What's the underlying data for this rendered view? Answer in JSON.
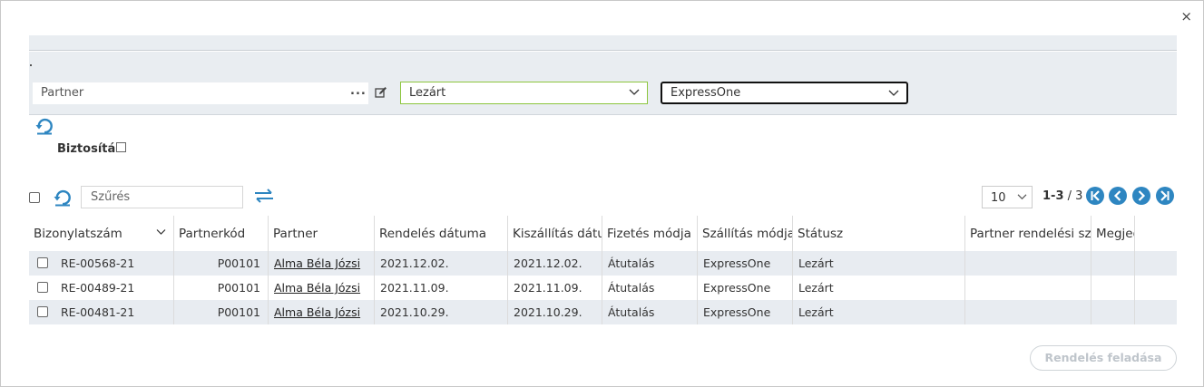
{
  "modal": {
    "close_symbol": "×"
  },
  "filters": {
    "partner_placeholder": "Partner",
    "partner_dots": "...",
    "status_value": "Lezárt",
    "shipping_value": "ExpressOne",
    "insurance_label": "Biztosítás"
  },
  "toolbar": {
    "filter_placeholder": "Szűrés",
    "page_size": "10",
    "range": "1-3",
    "total": " / 3"
  },
  "table": {
    "columns": [
      "Bizonylatszám",
      "Partnerkód",
      "Partner",
      "Rendelés dátuma",
      "Kiszállítás dátuma",
      "Fizetés módja",
      "Szállítás módja",
      "Státusz",
      "Partner rendelési száma",
      "Megjegyzés"
    ],
    "rows": [
      {
        "doc": "RE-00568-21",
        "code": "P00101",
        "partner": "Alma Béla Józsi",
        "order_date": "2021.12.02.",
        "ship_date": "2021.12.02.",
        "payment": "Átutalás",
        "shipping": "ExpressOne",
        "status": "Lezárt",
        "partner_ref": "",
        "note": ""
      },
      {
        "doc": "RE-00489-21",
        "code": "P00101",
        "partner": "Alma Béla Józsi",
        "order_date": "2021.11.09.",
        "ship_date": "2021.11.09.",
        "payment": "Átutalás",
        "shipping": "ExpressOne",
        "status": "Lezárt",
        "partner_ref": "",
        "note": ""
      },
      {
        "doc": "RE-00481-21",
        "code": "P00101",
        "partner": "Alma Béla Józsi",
        "order_date": "2021.10.29.",
        "ship_date": "2021.10.29.",
        "payment": "Átutalás",
        "shipping": "ExpressOne",
        "status": "Lezárt",
        "partner_ref": "",
        "note": ""
      }
    ]
  },
  "actions": {
    "submit_label": "Rendelés feladása"
  },
  "colors": {
    "accent": "#2e86c1",
    "valid_border": "#8cc63e",
    "row_stripe": "#e8ecf1",
    "panel_bg": "#e9edf1"
  },
  "icons": [
    "close-icon",
    "more-dots-icon",
    "edit-icon",
    "chevron-down-icon",
    "refresh-icon",
    "swap-icon",
    "first-page-icon",
    "prev-page-icon",
    "next-page-icon",
    "last-page-icon",
    "sort-chevron-icon"
  ]
}
